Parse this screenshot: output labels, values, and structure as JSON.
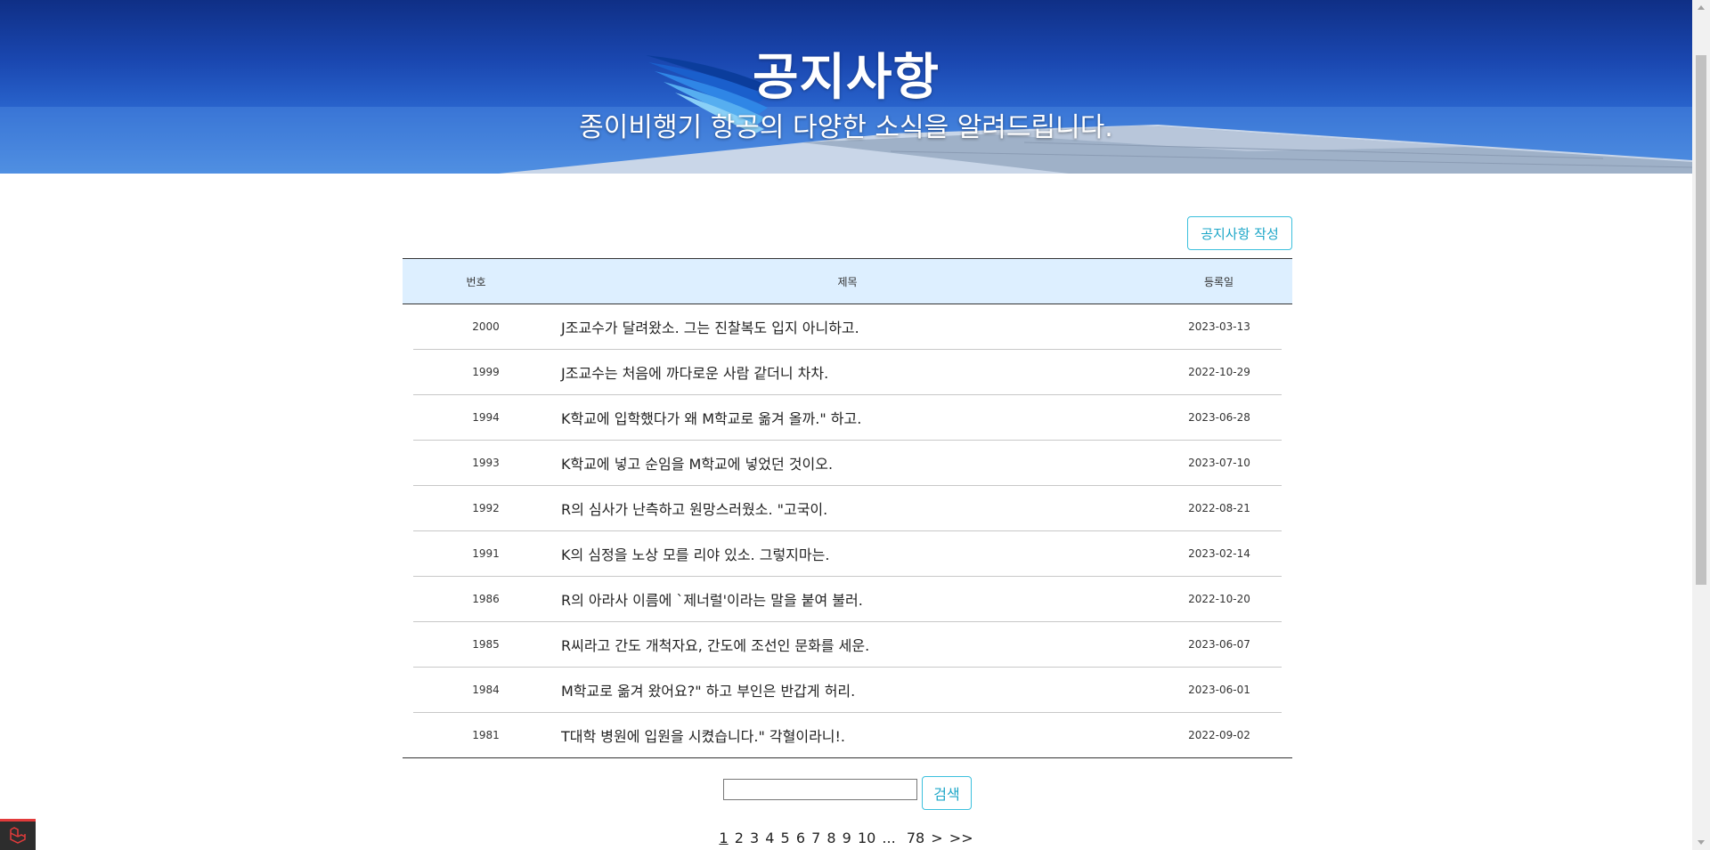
{
  "hero": {
    "title": "공지사항",
    "subtitle": "종이비행기 항공의 다양한 소식을 알려드립니다."
  },
  "toolbar": {
    "write_label": "공지사항 작성"
  },
  "board": {
    "columns": {
      "no": "번호",
      "title": "제목",
      "date": "등록일"
    },
    "rows": [
      {
        "no": "2000",
        "title": "J조교수가 달려왔소. 그는 진찰복도 입지 아니하고.",
        "date": "2023-03-13"
      },
      {
        "no": "1999",
        "title": "J조교수는 처음에 까다로운 사람 같더니 차차.",
        "date": "2022-10-29"
      },
      {
        "no": "1994",
        "title": "K학교에 입학했다가 왜 M학교로 옮겨 올까.\" 하고.",
        "date": "2023-06-28"
      },
      {
        "no": "1993",
        "title": "K학교에 넣고 순임을 M학교에 넣었던 것이오.",
        "date": "2023-07-10"
      },
      {
        "no": "1992",
        "title": "R의 심사가 난측하고 원망스러웠소. \"고국이.",
        "date": "2022-08-21"
      },
      {
        "no": "1991",
        "title": "K의 심정을 노상 모를 리야 있소. 그렇지마는.",
        "date": "2023-02-14"
      },
      {
        "no": "1986",
        "title": "R의 아라사 이름에 `제너럴'이라는 말을 붙여 불러.",
        "date": "2022-10-20"
      },
      {
        "no": "1985",
        "title": "R씨라고 간도 개척자요, 간도에 조선인 문화를 세운.",
        "date": "2023-06-07"
      },
      {
        "no": "1984",
        "title": "M학교로 옮겨 왔어요?\" 하고 부인은 반갑게 허리.",
        "date": "2023-06-01"
      },
      {
        "no": "1981",
        "title": "T대학 병원에 입원을 시켰습니다.\" 각혈이라니!.",
        "date": "2022-09-02"
      }
    ]
  },
  "search": {
    "value": "",
    "button_label": "검색"
  },
  "pagination": {
    "pages": [
      "1",
      "2",
      "3",
      "4",
      "5",
      "6",
      "7",
      "8",
      "9",
      "10"
    ],
    "current": "1",
    "ellipsis": "...",
    "last_page": "78",
    "next": ">",
    "last": ">>"
  },
  "colors": {
    "accent": "#1ea7c8",
    "header_bg": "#ddefff",
    "banner_top": "#0f2f86",
    "banner_bottom": "#4a8be0"
  },
  "icons": {
    "logo": "paper-airplane-wing-logo",
    "debug": "laravel-debugbar-icon"
  }
}
